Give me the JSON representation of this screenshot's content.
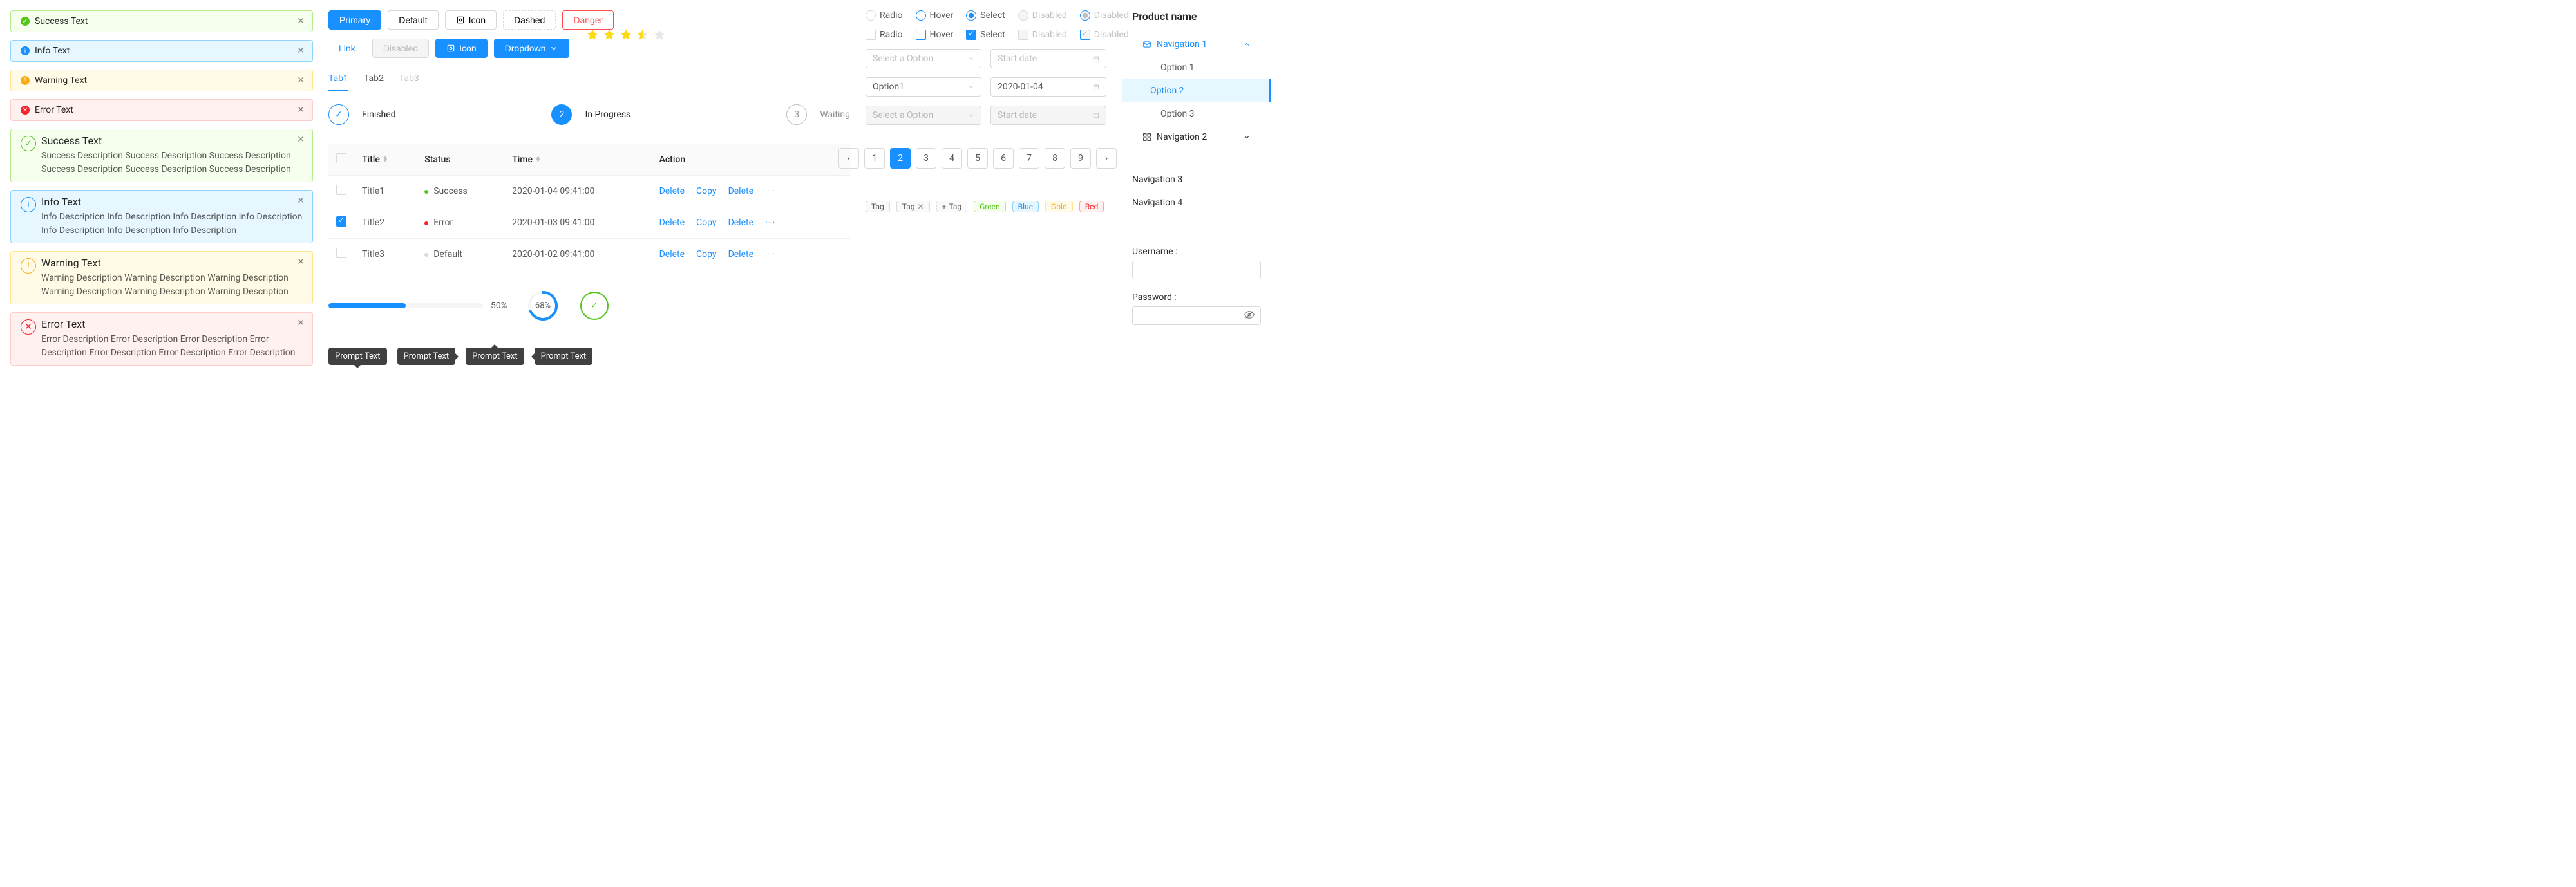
{
  "alerts_small": [
    {
      "type": "success",
      "label": "Success Text",
      "icon": "✓"
    },
    {
      "type": "info",
      "label": "Info Text",
      "icon": "i"
    },
    {
      "type": "warning",
      "label": "Warning Text",
      "icon": "!"
    },
    {
      "type": "error",
      "label": "Error Text",
      "icon": "✕"
    }
  ],
  "alerts_big": [
    {
      "type": "success",
      "title": "Success Text",
      "desc": "Success Description Success Description Success Description Success Description Success Description Success Description",
      "icon": "✓"
    },
    {
      "type": "info",
      "title": "Info Text",
      "desc": "Info Description Info Description Info Description Info Description Info Description Info Description Info Description",
      "icon": "i"
    },
    {
      "type": "warning",
      "title": "Warning Text",
      "desc": "Warning Description Warning Description Warning Description Warning Description Warning Description Warning Description",
      "icon": "!"
    },
    {
      "type": "error",
      "title": "Error Text",
      "desc": "Error Description Error Description Error Description Error Description Error Description Error Description Error Description",
      "icon": "✕"
    }
  ],
  "buttons": {
    "primary": "Primary",
    "default": "Default",
    "icon": "Icon",
    "dashed": "Dashed",
    "danger": "Danger",
    "link": "Link",
    "disabled": "Disabled",
    "icon2": "Icon",
    "dropdown": "Dropdown"
  },
  "tabs": [
    "Tab1",
    "Tab2",
    "Tab3"
  ],
  "steps": [
    {
      "label": "Finished",
      "state": "finish"
    },
    {
      "num": "2",
      "label": "In Progress",
      "state": "process"
    },
    {
      "num": "3",
      "label": "Waiting",
      "state": "wait"
    }
  ],
  "table": {
    "headers": {
      "title": "Title",
      "status": "Status",
      "time": "Time",
      "action": "Action"
    },
    "rows": [
      {
        "title": "Title1",
        "status": "Success",
        "dot": "success",
        "time": "2020-01-04  09:41:00",
        "checked": false
      },
      {
        "title": "Title2",
        "status": "Error",
        "dot": "error",
        "time": "2020-01-03  09:41:00",
        "checked": true
      },
      {
        "title": "Title3",
        "status": "Default",
        "dot": "default",
        "time": "2020-01-02  09:41:00",
        "checked": false
      }
    ],
    "actions": {
      "delete": "Delete",
      "copy": "Copy",
      "delete2": "Delete"
    }
  },
  "progress": {
    "percent": 50,
    "label": "50%",
    "circle_percent": 68,
    "circle_label": "68%"
  },
  "tooltips": [
    "Prompt Text",
    "Prompt Text",
    "Prompt Text",
    "Prompt Text"
  ],
  "radios": {
    "radio": "Radio",
    "hover": "Hover",
    "select": "Select",
    "disabled": "Disabled",
    "disabled2": "Disabled"
  },
  "checkboxes": {
    "radio": "Radio",
    "hover": "Hover",
    "select": "Select",
    "disabled": "Disabled",
    "disabled2": "Disabled"
  },
  "selects": {
    "placeholder": "Select a Option",
    "value": "Option1",
    "date_placeholder": "Start date",
    "date_value": "2020-01-04"
  },
  "pagination": [
    "1",
    "2",
    "3",
    "4",
    "5",
    "6",
    "7",
    "8",
    "9"
  ],
  "tags": {
    "tag": "Tag",
    "tag_close": "Tag",
    "add": "Tag",
    "green": "Green",
    "blue": "Blue",
    "gold": "Gold",
    "red": "Red"
  },
  "menu": {
    "title": "Product name",
    "nav1": "Navigation 1",
    "options": [
      "Option 1",
      "Option 2",
      "Option 3"
    ],
    "nav2": "Navigation 2",
    "nav3": "Navigation 3",
    "nav4": "Navigation 4",
    "username": "Username :",
    "password": "Password :"
  }
}
